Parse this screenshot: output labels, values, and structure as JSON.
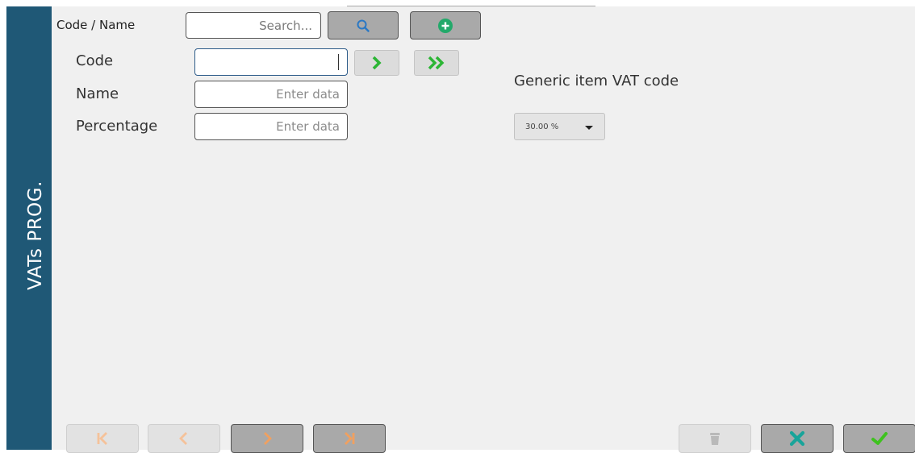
{
  "sidebar": {
    "title": "VATs PROG."
  },
  "search": {
    "label": "Code / Name",
    "placeholder": "Search..."
  },
  "form": {
    "code_label": "Code",
    "code_value": "",
    "name_label": "Name",
    "name_placeholder": "Enter data",
    "percentage_label": "Percentage",
    "percentage_placeholder": "Enter data"
  },
  "generic": {
    "label": "Generic item VAT code",
    "selected": "30.00 %"
  },
  "icons": {
    "search": "search-icon",
    "add": "plus-circle-icon",
    "next": "chevron-right-icon",
    "last": "double-chevron-right-icon",
    "first_page": "first-page-icon",
    "prev_page": "previous-page-icon",
    "next_page": "next-page-icon",
    "last_page": "last-page-icon",
    "delete": "trash-icon",
    "cancel": "close-icon",
    "confirm": "check-icon"
  },
  "colors": {
    "sidebar": "#1f5876",
    "accent_green": "#2bb534",
    "cancel_teal": "#19a49a",
    "pager_orange": "#f0a060"
  }
}
